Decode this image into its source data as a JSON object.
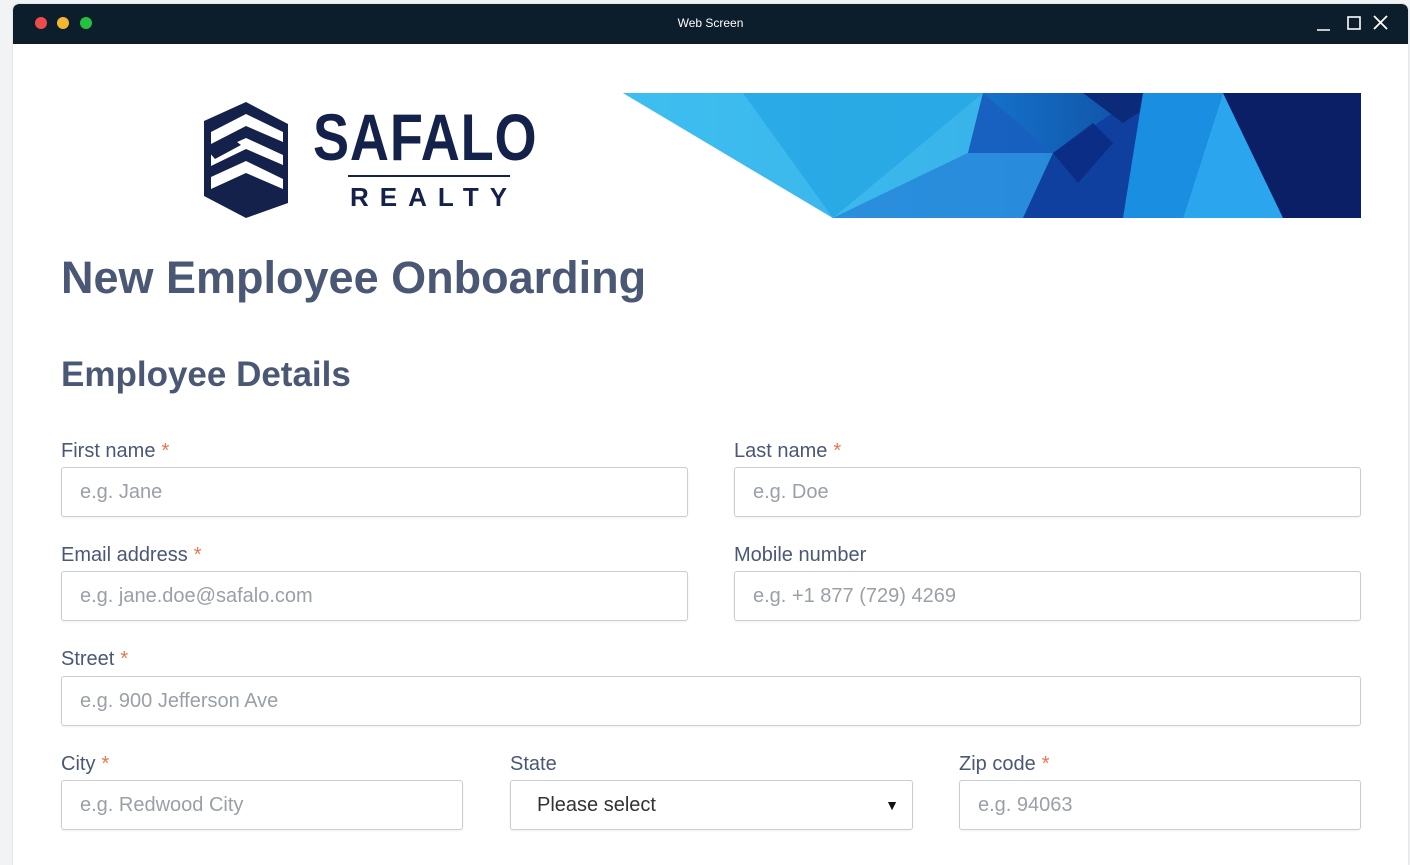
{
  "window": {
    "title": "Web Screen"
  },
  "logo": {
    "name": "SAFALO",
    "tagline": "REALTY"
  },
  "page_title": "New Employee Onboarding",
  "section_title": "Employee Details",
  "required_mark": "*",
  "fields": {
    "first_name": {
      "label": "First name",
      "placeholder": "e.g. Jane"
    },
    "last_name": {
      "label": "Last name",
      "placeholder": "e.g. Doe"
    },
    "email": {
      "label": "Email address",
      "placeholder": "e.g. jane.doe@safalo.com"
    },
    "mobile": {
      "label": "Mobile number",
      "placeholder": "e.g. +1 877 (729) 4269"
    },
    "street": {
      "label": "Street",
      "placeholder": "e.g. 900 Jefferson Ave"
    },
    "city": {
      "label": "City",
      "placeholder": "e.g. Redwood City"
    },
    "state": {
      "label": "State",
      "value": "Please select"
    },
    "zip": {
      "label": "Zip code",
      "placeholder": "e.g. 94063"
    }
  },
  "colors": {
    "titlebar": "#0c1e2c",
    "heading": "#4a5875",
    "required": "#e8754e",
    "brand_navy": "#14214a",
    "banner_blue": "#1e90e0"
  },
  "icons": [
    "close-dot",
    "minimize-dot",
    "maximize-dot",
    "minimize-icon",
    "maximize-icon",
    "close-icon",
    "chevron-down-icon"
  ]
}
